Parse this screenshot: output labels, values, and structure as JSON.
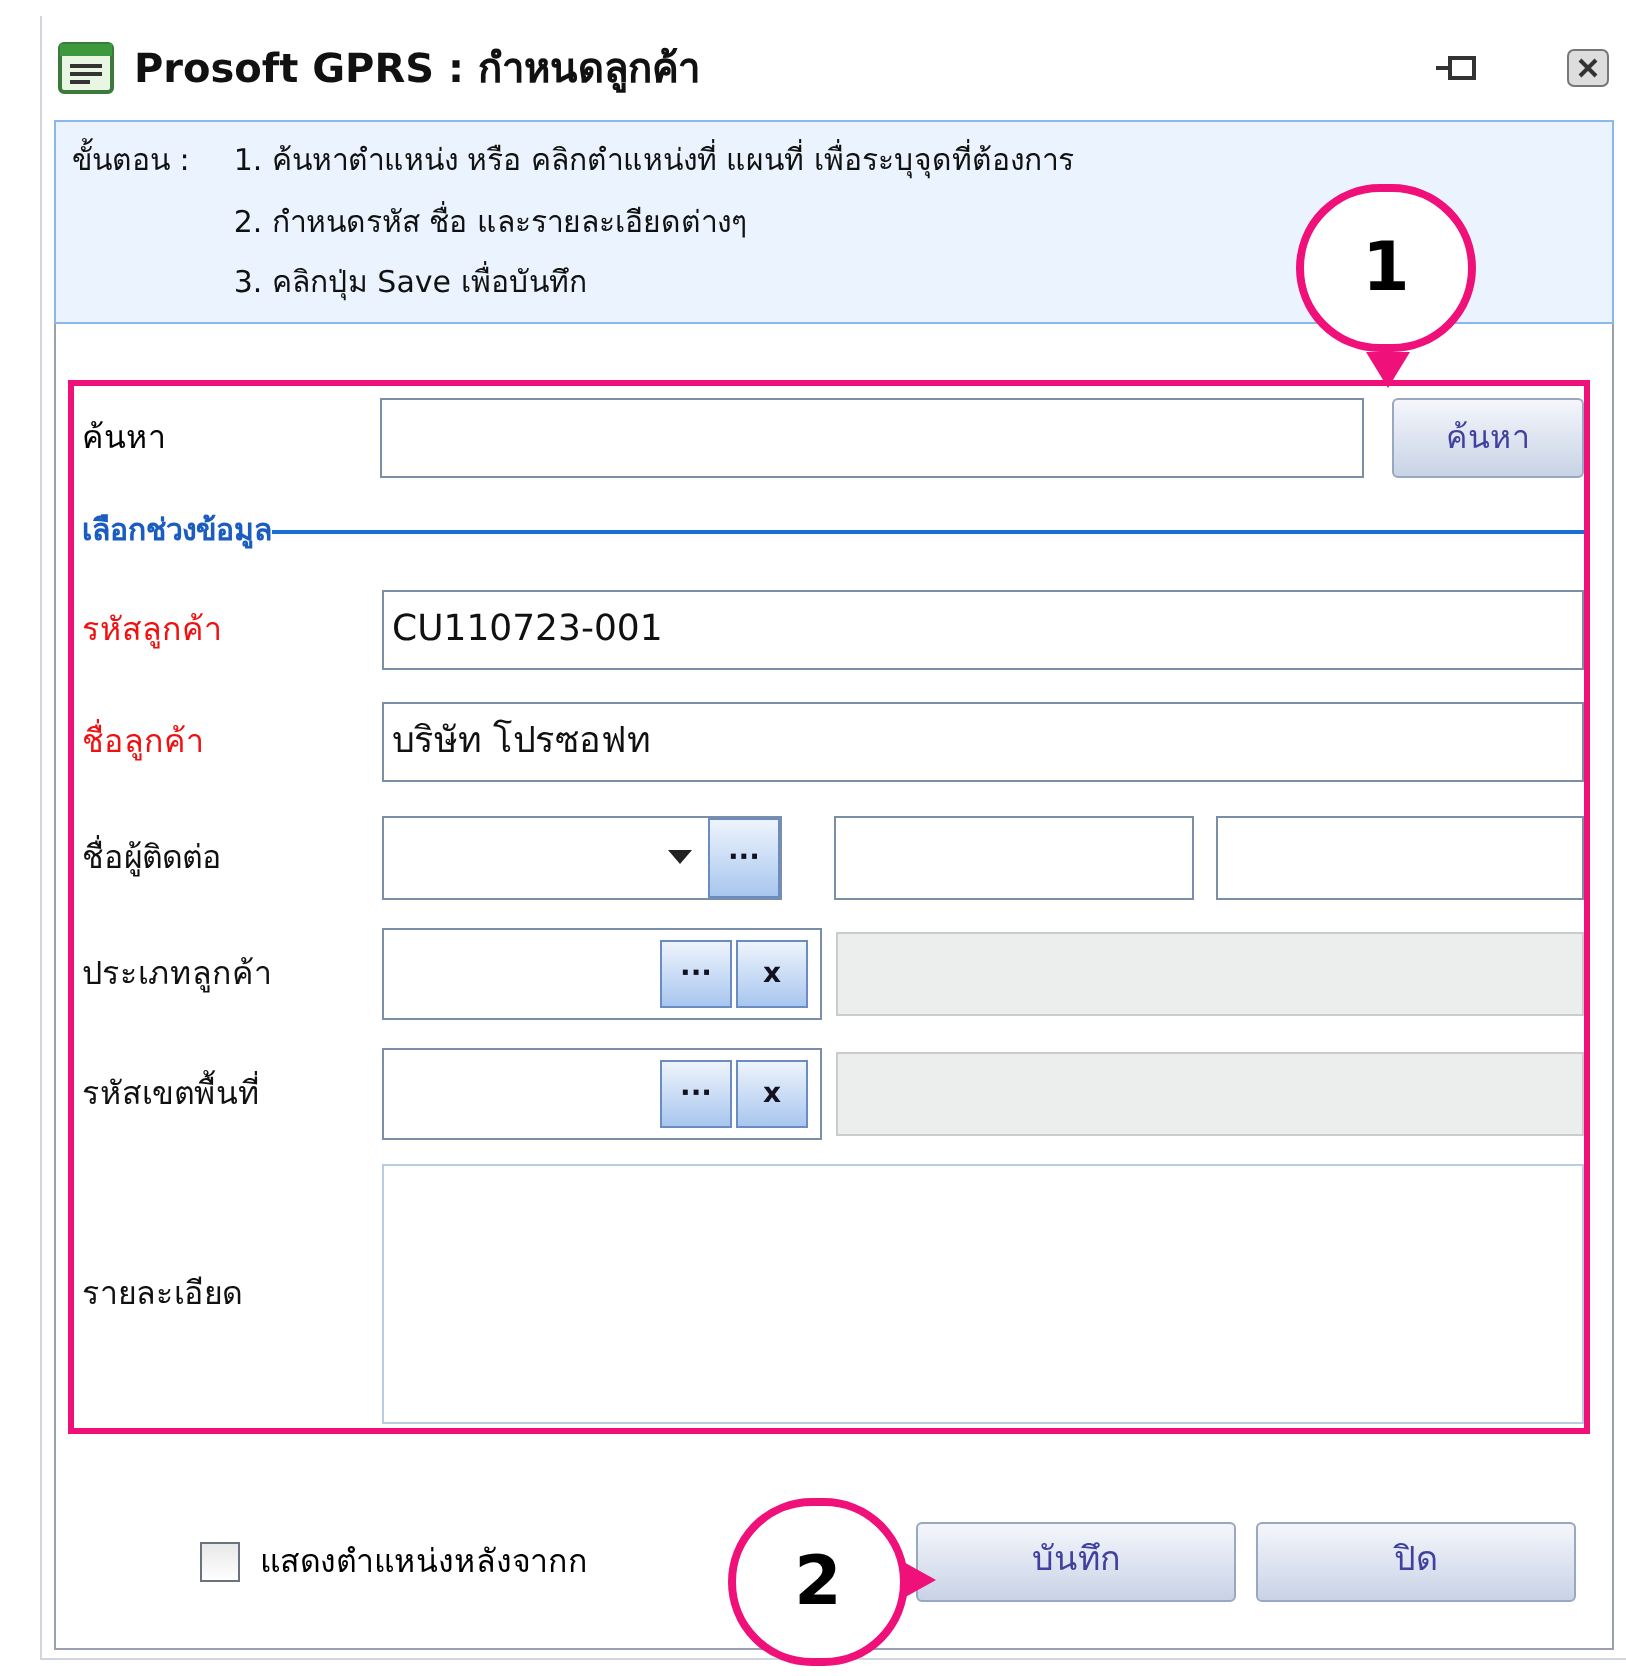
{
  "window": {
    "title": "Prosoft GPRS : กำหนดลูกค้า"
  },
  "instructions": {
    "label": "ขั้นตอน :",
    "steps": [
      "1. ค้นหาตำแหน่ง หรือ คลิกตำแหน่งที่ แผนที่ เพื่อระบุจุดที่ต้องการ",
      "2. กำหนดรหัส ชื่อ และรายละเอียดต่างๆ",
      "3. คลิกปุ่ม Save เพื่อบันทึก"
    ]
  },
  "search": {
    "label": "ค้นหา",
    "button": "ค้นหา"
  },
  "section": "เลือกช่วงข้อมูล",
  "fields": [
    {
      "kind": "text",
      "label": "รหัสลูกค้า",
      "required": true,
      "value": "CU110723-001"
    },
    {
      "kind": "text",
      "label": "ชื่อลูกค้า",
      "required": true,
      "value": "บริษัท โปรซอฟท"
    },
    {
      "kind": "contact",
      "label": "ชื่อผู้ติดต่อ",
      "required": false,
      "browse_button": "···"
    },
    {
      "kind": "lookup",
      "label": "ประเภทลูกค้า",
      "required": false,
      "browse_button": "···",
      "clear_button": "x"
    },
    {
      "kind": "lookup",
      "label": "รหัสเขตพื้นที่",
      "required": false,
      "browse_button": "···",
      "clear_button": "x"
    },
    {
      "kind": "textarea",
      "label": "รายละเอียด",
      "required": false
    }
  ],
  "footer": {
    "checkbox": {
      "label": "แสดงตำแหน่งหลังจากก",
      "checked": false
    },
    "buttons": [
      "บันทึก",
      "ปิด"
    ]
  },
  "callouts": [
    {
      "number": "1"
    },
    {
      "number": "2"
    }
  ]
}
